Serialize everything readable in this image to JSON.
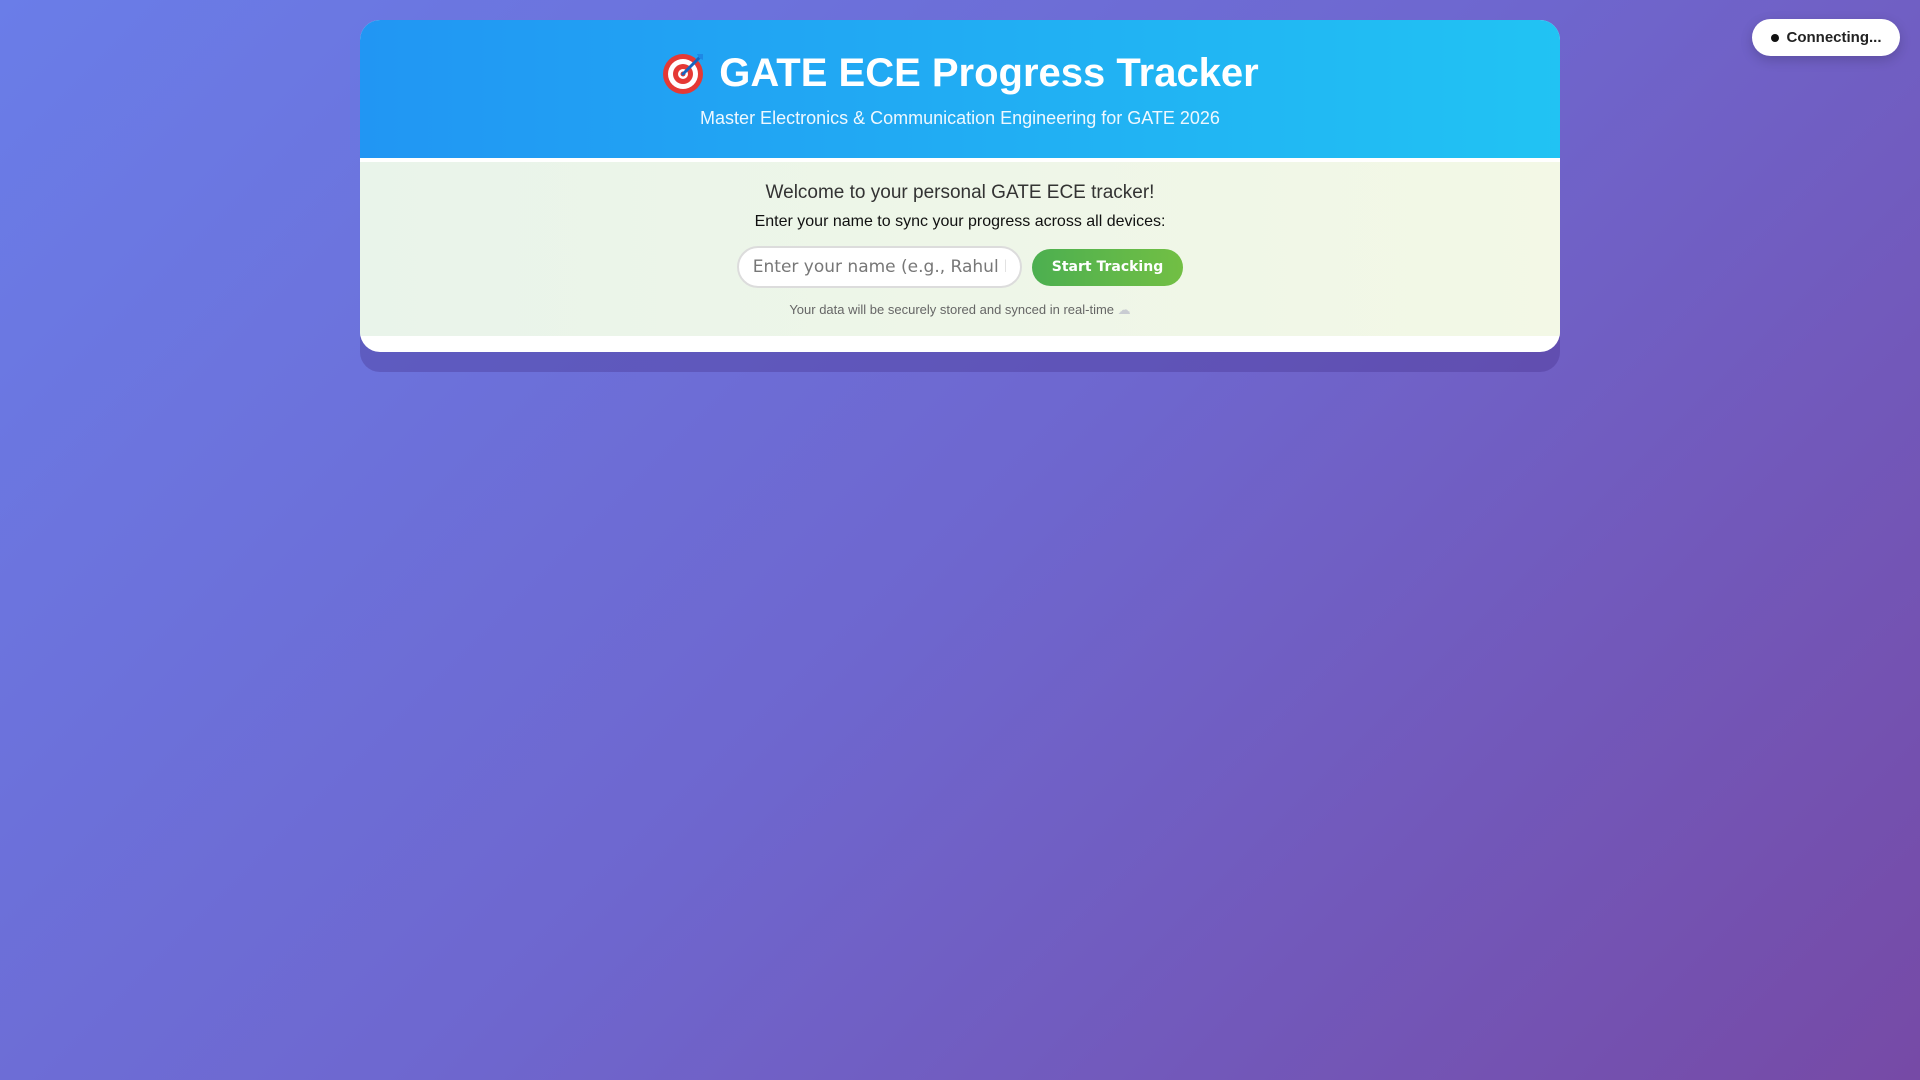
{
  "connection_status": {
    "label": "Connecting..."
  },
  "header": {
    "icon": "target-icon",
    "title": "GATE ECE Progress Tracker",
    "subtitle": "Master Electronics & Communication Engineering for GATE 2026"
  },
  "login": {
    "welcome": "Welcome to your personal GATE ECE tracker!",
    "instruction": "Enter your name to sync your progress across all devices:",
    "name_placeholder": "Enter your name (e.g., Rahul Kumar)",
    "name_value": "",
    "start_button": "Start Tracking",
    "note": "Your data will be securely stored and synced in real-time",
    "note_icon": "cloud-icon"
  },
  "colors": {
    "header_start": "#2196f3",
    "header_end": "#21c3f3",
    "button_start": "#4caf50",
    "button_end": "#72bf44",
    "background_start": "#6a7de8",
    "background_end": "#764aa6"
  }
}
